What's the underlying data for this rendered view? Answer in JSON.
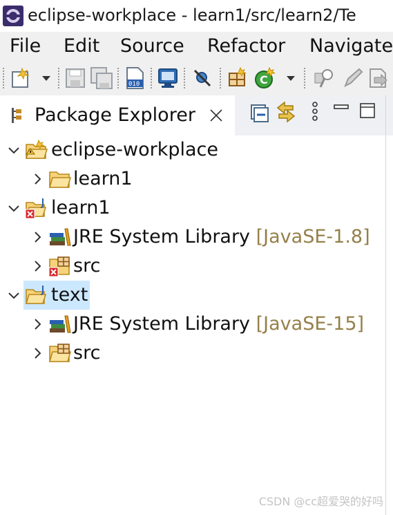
{
  "window": {
    "title": "eclipse-workplace - learn1/src/learn2/Te"
  },
  "menu": {
    "items": [
      "File",
      "Edit",
      "Source",
      "Refactor",
      "Navigate"
    ]
  },
  "view": {
    "tab_title": "Package Explorer"
  },
  "tree": {
    "rows": [
      {
        "label": "eclipse-workplace",
        "decoration": "",
        "expanded": true,
        "icon": "working-set-icon"
      },
      {
        "label": "learn1",
        "decoration": "",
        "expanded": false,
        "icon": "folder-icon"
      },
      {
        "label": "learn1",
        "decoration": "",
        "expanded": true,
        "icon": "java-project-error-icon"
      },
      {
        "label": "JRE System Library",
        "decoration": "[JavaSE-1.8]",
        "expanded": false,
        "icon": "library-icon"
      },
      {
        "label": "src",
        "decoration": "",
        "expanded": false,
        "icon": "package-folder-error-icon"
      },
      {
        "label": "text",
        "decoration": "",
        "expanded": true,
        "icon": "java-project-icon",
        "selected": true
      },
      {
        "label": "JRE System Library",
        "decoration": "[JavaSE-15]",
        "expanded": false,
        "icon": "library-icon"
      },
      {
        "label": "src",
        "decoration": "",
        "expanded": false,
        "icon": "package-folder-icon"
      }
    ]
  },
  "watermark": "CSDN @cc超爱哭的好吗",
  "colors": {
    "selection": "#cce8ff",
    "decoration": "#95804a",
    "folder": "#e8b84a"
  }
}
